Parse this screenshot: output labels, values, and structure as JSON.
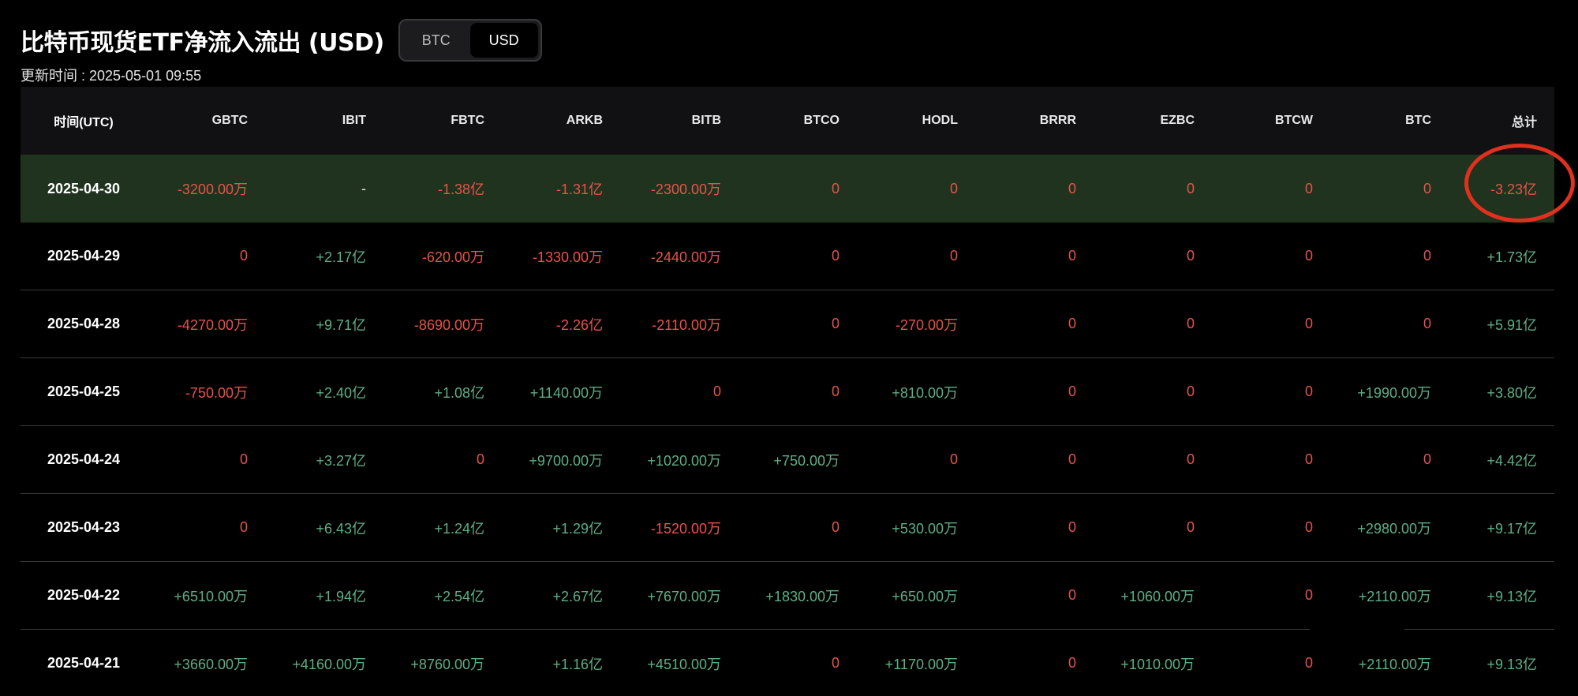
{
  "header": {
    "title": "比特币现货ETF净流入流出 (USD)",
    "toggle": [
      {
        "label": "BTC",
        "active": false
      },
      {
        "label": "USD",
        "active": true
      }
    ],
    "updated": "更新时间 : 2025-05-01 09:55"
  },
  "table": {
    "columns": [
      "时间(UTC)",
      "GBTC",
      "IBIT",
      "FBTC",
      "ARKB",
      "BITB",
      "BTCO",
      "HODL",
      "BRRR",
      "EZBC",
      "BTCW",
      "BTC",
      "总计"
    ],
    "rows": [
      {
        "date": "2025-04-30",
        "highlight": true,
        "cells": [
          "-3200.00万",
          "-",
          "-1.38亿",
          "-1.31亿",
          "-2300.00万",
          "0",
          "0",
          "0",
          "0",
          "0",
          "0",
          "-3.23亿"
        ]
      },
      {
        "date": "2025-04-29",
        "highlight": false,
        "cells": [
          "0",
          "+2.17亿",
          "-620.00万",
          "-1330.00万",
          "-2440.00万",
          "0",
          "0",
          "0",
          "0",
          "0",
          "0",
          "+1.73亿"
        ]
      },
      {
        "date": "2025-04-28",
        "highlight": false,
        "cells": [
          "-4270.00万",
          "+9.71亿",
          "-8690.00万",
          "-2.26亿",
          "-2110.00万",
          "0",
          "-270.00万",
          "0",
          "0",
          "0",
          "0",
          "+5.91亿"
        ]
      },
      {
        "date": "2025-04-25",
        "highlight": false,
        "cells": [
          "-750.00万",
          "+2.40亿",
          "+1.08亿",
          "+1140.00万",
          "0",
          "0",
          "+810.00万",
          "0",
          "0",
          "0",
          "+1990.00万",
          "+3.80亿"
        ]
      },
      {
        "date": "2025-04-24",
        "highlight": false,
        "cells": [
          "0",
          "+3.27亿",
          "0",
          "+9700.00万",
          "+1020.00万",
          "+750.00万",
          "0",
          "0",
          "0",
          "0",
          "0",
          "+4.42亿"
        ]
      },
      {
        "date": "2025-04-23",
        "highlight": false,
        "cells": [
          "0",
          "+6.43亿",
          "+1.24亿",
          "+1.29亿",
          "-1520.00万",
          "0",
          "+530.00万",
          "0",
          "0",
          "0",
          "+2980.00万",
          "+9.17亿"
        ]
      },
      {
        "date": "2025-04-22",
        "highlight": false,
        "cells": [
          "+6510.00万",
          "+1.94亿",
          "+2.54亿",
          "+2.67亿",
          "+7670.00万",
          "+1830.00万",
          "+650.00万",
          "0",
          "+1060.00万",
          "0",
          "+2110.00万",
          "+9.13亿"
        ]
      },
      {
        "date": "2025-04-21",
        "highlight": false,
        "cells": [
          "+3660.00万",
          "+4160.00万",
          "+8760.00万",
          "+1.16亿",
          "+4510.00万",
          "0",
          "+1170.00万",
          "0",
          "+1010.00万",
          "0",
          "+2110.00万",
          "+9.13亿"
        ]
      }
    ]
  },
  "colors": {
    "negative": "#e5534b",
    "positive": "#5fae86",
    "highlight_row": "#20331e",
    "annotation": "#e0301e"
  }
}
